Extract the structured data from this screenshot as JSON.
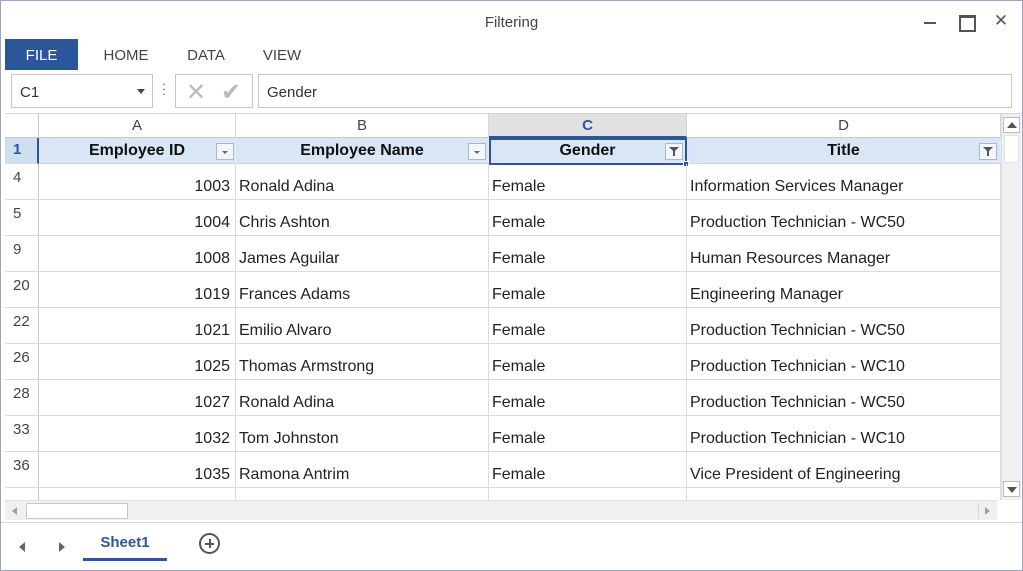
{
  "window": {
    "title": "Filtering"
  },
  "ribbon": {
    "tabs": [
      "FILE",
      "HOME",
      "DATA",
      "VIEW"
    ]
  },
  "formula_bar": {
    "name_box": "C1",
    "formula": "Gender"
  },
  "grid": {
    "columns": [
      "A",
      "B",
      "C",
      "D"
    ],
    "selected_column": "C",
    "header_row": {
      "number": "1",
      "cells": [
        "Employee ID",
        "Employee Name",
        "Gender",
        "Title"
      ]
    },
    "rows": [
      {
        "number": "4",
        "cells": [
          "1003",
          "Ronald Adina",
          "Female",
          "Information Services Manager"
        ]
      },
      {
        "number": "5",
        "cells": [
          "1004",
          "Chris Ashton",
          "Female",
          "Production Technician - WC50"
        ]
      },
      {
        "number": "9",
        "cells": [
          "1008",
          "James Aguilar",
          "Female",
          "Human Resources Manager"
        ]
      },
      {
        "number": "20",
        "cells": [
          "1019",
          "Frances Adams",
          "Female",
          "Engineering Manager"
        ]
      },
      {
        "number": "22",
        "cells": [
          "1021",
          "Emilio Alvaro",
          "Female",
          "Production Technician - WC50"
        ]
      },
      {
        "number": "26",
        "cells": [
          "1025",
          "Thomas Armstrong",
          "Female",
          "Production Technician - WC10"
        ]
      },
      {
        "number": "28",
        "cells": [
          "1027",
          "Ronald Adina",
          "Female",
          "Production Technician - WC50"
        ]
      },
      {
        "number": "33",
        "cells": [
          "1032",
          "Tom Johnston",
          "Female",
          "Production Technician - WC10"
        ]
      },
      {
        "number": "36",
        "cells": [
          "1035",
          "Ramona Antrim",
          "Female",
          "Vice President of Engineering"
        ]
      }
    ]
  },
  "sheets": {
    "tabs": [
      "Sheet1"
    ],
    "active": "Sheet1"
  },
  "colors": {
    "accent": "#2b579a",
    "selection": "#2f5597",
    "header_fill": "#d9e6f5"
  }
}
